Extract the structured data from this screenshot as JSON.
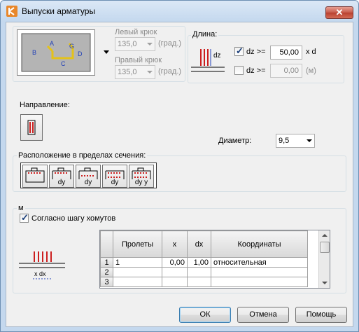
{
  "window": {
    "title": "Выпуски арматуры",
    "close_glyph": "✕"
  },
  "hook_preview": {
    "labels": [
      "A",
      "B",
      "C",
      "D",
      "G"
    ]
  },
  "left_hook": {
    "label": "Левый крюк",
    "value": "135,0",
    "unit": "(град.)"
  },
  "right_hook": {
    "label": "Правый крюк",
    "value": "135,0",
    "unit": "(град.)"
  },
  "length": {
    "title": "Длина:",
    "diagram_label": "dz",
    "row1": {
      "label": "dz >=",
      "value": "50,00",
      "unit": "x d",
      "checked": true
    },
    "row2": {
      "label": "dz >=",
      "value": "0,00",
      "unit": "(м)",
      "checked": false
    }
  },
  "direction": {
    "label": "Направление:"
  },
  "diameter": {
    "label": "Диаметр:",
    "value": "9,5"
  },
  "placement": {
    "title": "Расположение в пределах сечения:",
    "buttons": [
      {
        "name": "placement-1",
        "sub": ""
      },
      {
        "name": "placement-2",
        "sub": "dy"
      },
      {
        "name": "placement-3",
        "sub": "dy"
      },
      {
        "name": "placement-4",
        "sub": "dy"
      },
      {
        "name": "placement-5",
        "sub": "dy y"
      }
    ]
  },
  "spacing": {
    "title": "м",
    "checkbox_label": "Согласно шагу хомутов",
    "checked": true,
    "diagram_label": "x dx"
  },
  "table": {
    "columns": [
      "Пролеты",
      "x",
      "dx",
      "Координаты"
    ],
    "rows": [
      {
        "n": "1",
        "spans": "1",
        "x": "0,00",
        "dx": "1,00",
        "coords": "относительная"
      },
      {
        "n": "2",
        "spans": "",
        "x": "",
        "dx": "",
        "coords": ""
      },
      {
        "n": "3",
        "spans": "",
        "x": "",
        "dx": "",
        "coords": ""
      }
    ]
  },
  "buttons": {
    "ok": "ОК",
    "cancel": "Отмена",
    "help": "Помощь"
  },
  "colors": {
    "accent": "#e8872a",
    "rebar_red": "#cc1f1f",
    "hook_yellow": "#e4c21a"
  }
}
